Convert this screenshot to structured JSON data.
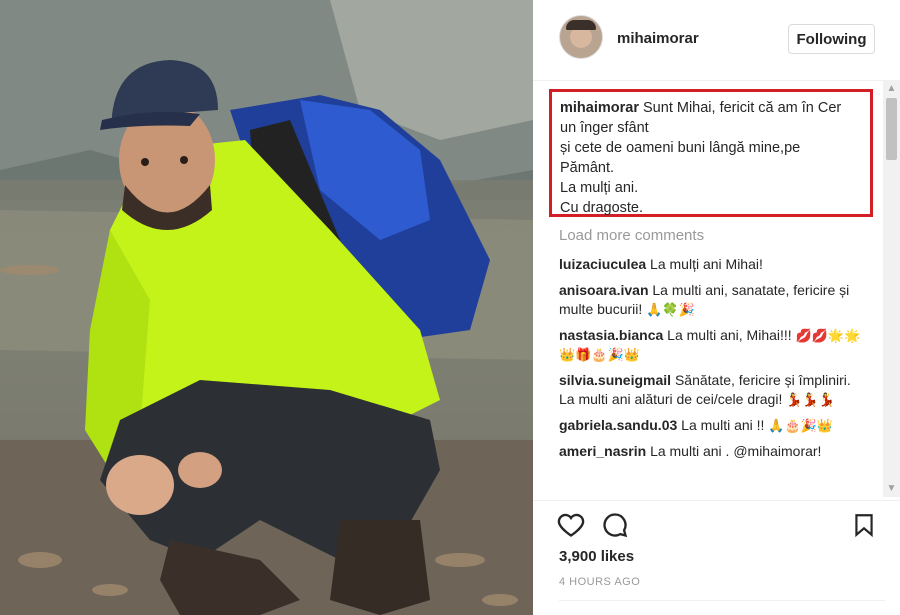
{
  "post": {
    "username": "mihaimorar",
    "follow_label": "Following",
    "caption_user": "mihaimorar",
    "caption_lines": [
      "Sunt Mihai, fericit că am în Cer",
      "un înger sfânt",
      "și cete de oameni buni lângă mine,pe",
      "Pământ.",
      "La mulți ani.",
      "Cu dragoste."
    ],
    "load_more": "Load more comments",
    "likes": "3,900 likes",
    "time": "4 HOURS AGO"
  },
  "comments": [
    {
      "user": "luizaciuculea",
      "text": "La mulți ani Mihai!",
      "emoji": ""
    },
    {
      "user": "anisoara.ivan",
      "text": "La multi ani, sanatate, fericire și multe bucurii!",
      "emoji": "🙏🍀🎉"
    },
    {
      "user": "nastasia.bianca",
      "text": "La multi ani, Mihai!!!",
      "emoji": "💋💋🌟🌟👑🎁🎂🎉👑"
    },
    {
      "user": "silvia.suneigmail",
      "text": "Sănătate, fericire și împliniri. La multi ani alături de cei/cele dragi!",
      "emoji": "💃💃💃"
    },
    {
      "user": "gabriela.sandu.03",
      "text": "La multi ani !!",
      "emoji": "🙏🎂🎉👑"
    },
    {
      "user": "ameri_nasrin",
      "text": "La multi ani . @mihaimorar!",
      "emoji": ""
    }
  ],
  "icons": {
    "avatar": "avatar",
    "heart": "heart-icon",
    "comment": "comment-icon",
    "bookmark": "bookmark-icon"
  }
}
